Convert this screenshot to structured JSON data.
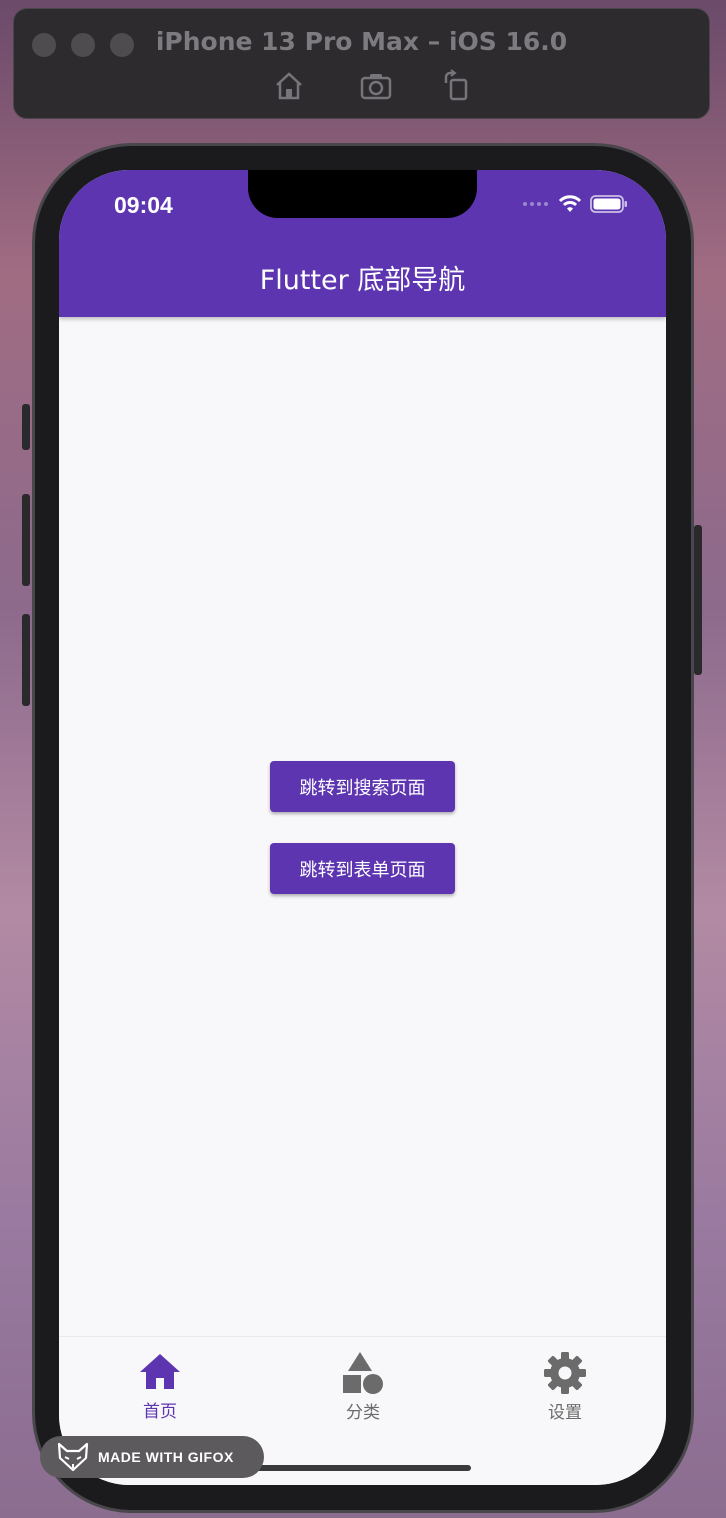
{
  "simulator": {
    "title": "iPhone 13 Pro Max – iOS 16.0",
    "tools": [
      "home-icon",
      "screenshot-icon",
      "rotate-icon"
    ]
  },
  "status_bar": {
    "time": "09:04",
    "icons": [
      "cellular-dots-icon",
      "wifi-icon",
      "battery-icon"
    ]
  },
  "app_bar": {
    "title": "Flutter 底部导航",
    "color": "#5d35b1"
  },
  "main": {
    "buttons": [
      {
        "label": "跳转到搜索页面"
      },
      {
        "label": "跳转到表单页面"
      }
    ]
  },
  "bottom_nav": {
    "active_color": "#5d35b1",
    "inactive_color": "#6b6b6b",
    "items": [
      {
        "label": "首页",
        "icon": "home-icon",
        "active": true
      },
      {
        "label": "分类",
        "icon": "category-shapes-icon",
        "active": false
      },
      {
        "label": "设置",
        "icon": "gear-icon",
        "active": false
      }
    ]
  },
  "watermark": {
    "text": "MADE WITH GIFOX"
  }
}
